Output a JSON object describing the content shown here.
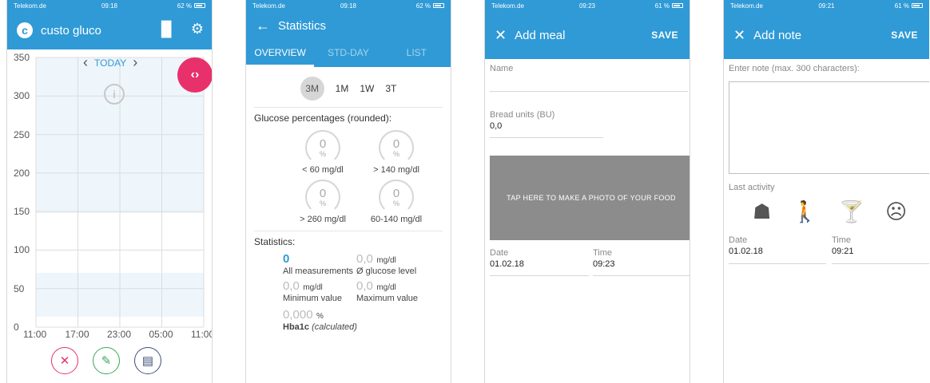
{
  "screen1": {
    "status": {
      "carrier": "Telekom.de",
      "time": "09:18",
      "battery": "62 %"
    },
    "app_title": "custo gluco",
    "logo_letter": "c",
    "icons": {
      "stats": "bar-chart-icon",
      "settings": "gear-icon"
    },
    "today_label": "TODAY",
    "y_ticks": [
      "350",
      "300",
      "250",
      "200",
      "150",
      "100",
      "50",
      "0"
    ],
    "x_ticks": [
      "11:00",
      "17:00",
      "23:00",
      "05:00",
      "11:00"
    ],
    "colors": {
      "accent": "#2f9ad6",
      "fab": "#e8306b",
      "meal": "#e8306b",
      "insulin": "#3aa85a",
      "note": "#3f4f7a"
    }
  },
  "screen2": {
    "status": {
      "carrier": "Telekom.de",
      "time": "09:18",
      "battery": "62 %"
    },
    "title": "Statistics",
    "tabs": [
      "OVERVIEW",
      "STD-DAY",
      "LIST"
    ],
    "ranges": [
      "3M",
      "1M",
      "1W",
      "3T"
    ],
    "selected_range": "3M",
    "gauges_title": "Glucose percentages (rounded):",
    "gauges": [
      {
        "value": "0",
        "pct": "%",
        "label": "< 60 mg/dl"
      },
      {
        "value": "0",
        "pct": "%",
        "label": "> 140 mg/dl"
      },
      {
        "value": "0",
        "pct": "%",
        "label": "> 260 mg/dl"
      },
      {
        "value": "0",
        "pct": "%",
        "label": "60-140 mg/dl"
      }
    ],
    "stats_title": "Statistics:",
    "stats": [
      {
        "num": "0",
        "unit": "",
        "label": "All measurements"
      },
      {
        "num": "0,0",
        "unit": "mg/dl",
        "label": "Ø glucose level"
      },
      {
        "num": "0,0",
        "unit": "mg/dl",
        "label": "Minimum value"
      },
      {
        "num": "0,0",
        "unit": "mg/dl",
        "label": "Maximum value"
      }
    ],
    "hba1c": {
      "num": "0,000",
      "unit": "%",
      "label": "Hba1c",
      "note": "(calculated)"
    }
  },
  "screen3": {
    "status": {
      "carrier": "Telekom.de",
      "time": "09:23",
      "battery": "61 %"
    },
    "title": "Add meal",
    "save": "SAVE",
    "name_label": "Name",
    "bu_label": "Bread units (BU)",
    "bu_value": "0,0",
    "photo_text": "TAP HERE TO MAKE A PHOTO OF YOUR FOOD",
    "date_label": "Date",
    "date_value": "01.02.18",
    "time_label": "Time",
    "time_value": "09:23"
  },
  "screen4": {
    "status": {
      "carrier": "Telekom.de",
      "time": "09:21",
      "battery": "61 %"
    },
    "title": "Add note",
    "save": "SAVE",
    "note_label": "Enter note (max. 300 characters):",
    "activity_label": "Last activity",
    "date_label": "Date",
    "date_value": "01.02.18",
    "time_label": "Time",
    "time_value": "09:21"
  }
}
